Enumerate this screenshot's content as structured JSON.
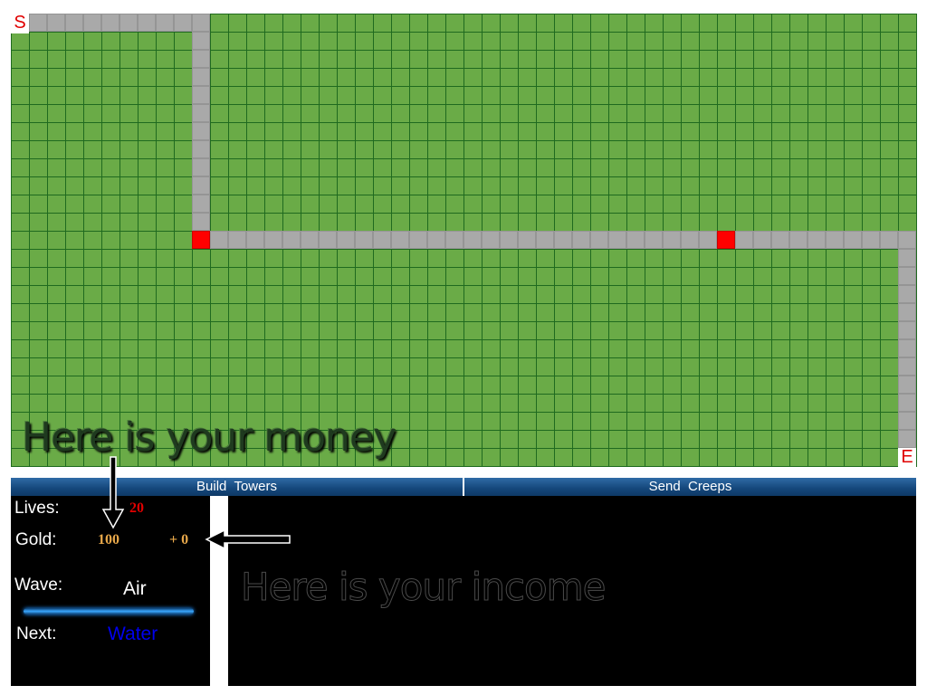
{
  "board": {
    "start_label": "S",
    "end_label": "E",
    "path_color": "#a9a9a9",
    "grass_color": "#6aab47",
    "tower_color": "#ff0000"
  },
  "tabs": {
    "build_label": "Build  Towers",
    "send_label": "Send  Creeps"
  },
  "stats": {
    "lives_label": "Lives:",
    "lives_value": "20",
    "gold_label": "Gold:",
    "gold_value": "100",
    "income_value": "+ 0",
    "wave_label": "Wave:",
    "wave_value": "Air",
    "next_label": "Next:",
    "next_value": "Water",
    "wave_progress": 0.0
  },
  "hints": {
    "money": "Here is your money",
    "income": "Here is your income"
  },
  "colors": {
    "lives": "#e00000",
    "gold": "#e8a84a",
    "next_wave": "#0000ee",
    "tab_bar": "#14467a"
  }
}
